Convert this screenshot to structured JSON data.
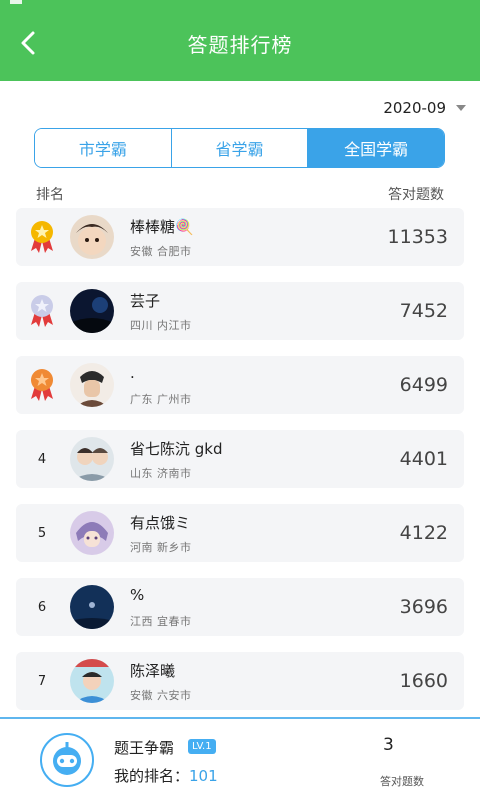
{
  "header": {
    "title": "答题排行榜"
  },
  "filter": {
    "date": "2020-09"
  },
  "tabs": [
    {
      "label": "市学霸",
      "active": false
    },
    {
      "label": "省学霸",
      "active": false
    },
    {
      "label": "全国学霸",
      "active": true
    }
  ],
  "columns": {
    "rank": "排名",
    "count": "答对题数"
  },
  "rows": [
    {
      "rank": "1",
      "medal": "gold-medal-icon",
      "name": "棒棒糖🍭",
      "location": "安徽 合肥市",
      "count": "11353"
    },
    {
      "rank": "2",
      "medal": "silver-medal-icon",
      "name": "芸子",
      "location": "四川 内江市",
      "count": "7452"
    },
    {
      "rank": "3",
      "medal": "bronze-medal-icon",
      "name": ".",
      "location": "广东 广州市",
      "count": "6499"
    },
    {
      "rank": "4",
      "medal": "",
      "name": "省七陈沆 gkd",
      "location": "山东 济南市",
      "count": "4401"
    },
    {
      "rank": "5",
      "medal": "",
      "name": "有点饿ミ",
      "location": "河南 新乡市",
      "count": "4122"
    },
    {
      "rank": "6",
      "medal": "",
      "name": "%",
      "location": "江西 宜春市",
      "count": "3696"
    },
    {
      "rank": "7",
      "medal": "",
      "name": "陈泽曦",
      "location": "安徽 六安市",
      "count": "1660"
    }
  ],
  "footer": {
    "name": "题王争霸",
    "level": "LV.1",
    "rank_label": "我的排名：",
    "rank_value": "101",
    "count": "3",
    "count_label": "答对题数"
  },
  "colors": {
    "header": "#4cc35a",
    "accent": "#3aa3e8",
    "gold": "#f5b700",
    "silver": "#c9cce8",
    "bronze": "#f08a34"
  }
}
